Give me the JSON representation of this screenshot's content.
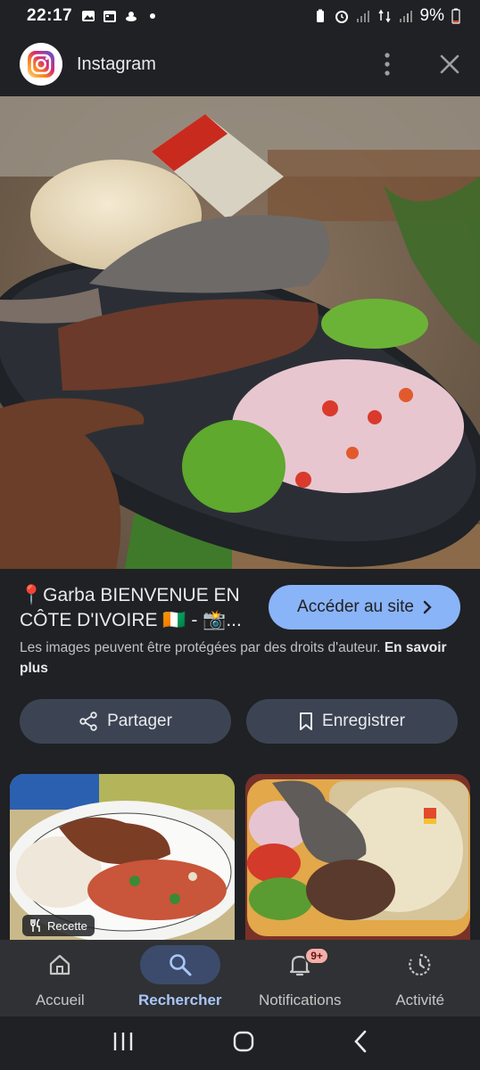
{
  "status_bar": {
    "time": "22:17",
    "battery": "9%"
  },
  "header": {
    "app_name": "Instagram",
    "brand_color": "#d6249f"
  },
  "image": {
    "title": "📍Garba BIENVENUE EN CÔTE D'IVOIRE 🇨🇮 - 📸...",
    "visit_label": "Accéder au site",
    "copyright_text": "Les images peuvent être protégées par des droits d'auteur.",
    "learn_more": "En savoir plus"
  },
  "actions": {
    "share_label": "Partager",
    "save_label": "Enregistrer"
  },
  "related": {
    "badge_label": "Recette"
  },
  "bottom_nav": {
    "items": [
      {
        "label": "Accueil",
        "icon": "home-icon"
      },
      {
        "label": "Rechercher",
        "icon": "search-icon"
      },
      {
        "label": "Notifications",
        "icon": "bell-icon"
      },
      {
        "label": "Activité",
        "icon": "history-icon"
      }
    ],
    "notif_badge": "9+",
    "accent_color": "#a8c7fa"
  }
}
